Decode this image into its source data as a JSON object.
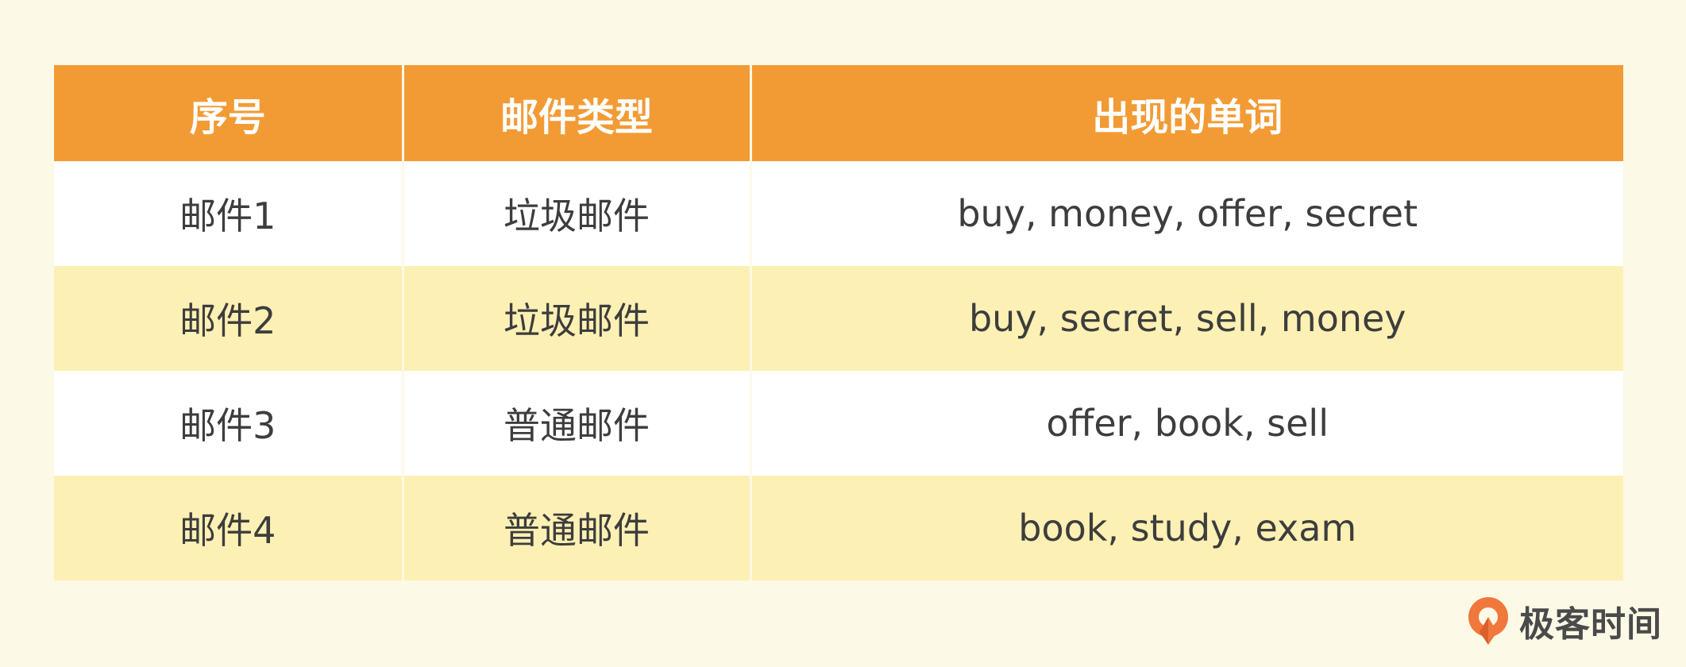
{
  "table": {
    "headers": [
      "序号",
      "邮件类型",
      "出现的单词"
    ],
    "rows": [
      {
        "id": "邮件1",
        "type": "垃圾邮件",
        "words": "buy, money, offer, secret"
      },
      {
        "id": "邮件2",
        "type": "垃圾邮件",
        "words": "buy, secret, sell, money"
      },
      {
        "id": "邮件3",
        "type": "普通邮件",
        "words": "offer, book, sell"
      },
      {
        "id": "邮件4",
        "type": "普通邮件",
        "words": "book, study, exam"
      }
    ]
  },
  "brand": {
    "name": "极客时间",
    "logo_icon": "geektime-logo-icon",
    "logo_color": "#f0783c"
  },
  "colors": {
    "header_bg": "#f29b35",
    "row_alt_bg": "#fdf0b4",
    "row_bg": "#ffffff",
    "page_bg": "#fdf9e7"
  }
}
